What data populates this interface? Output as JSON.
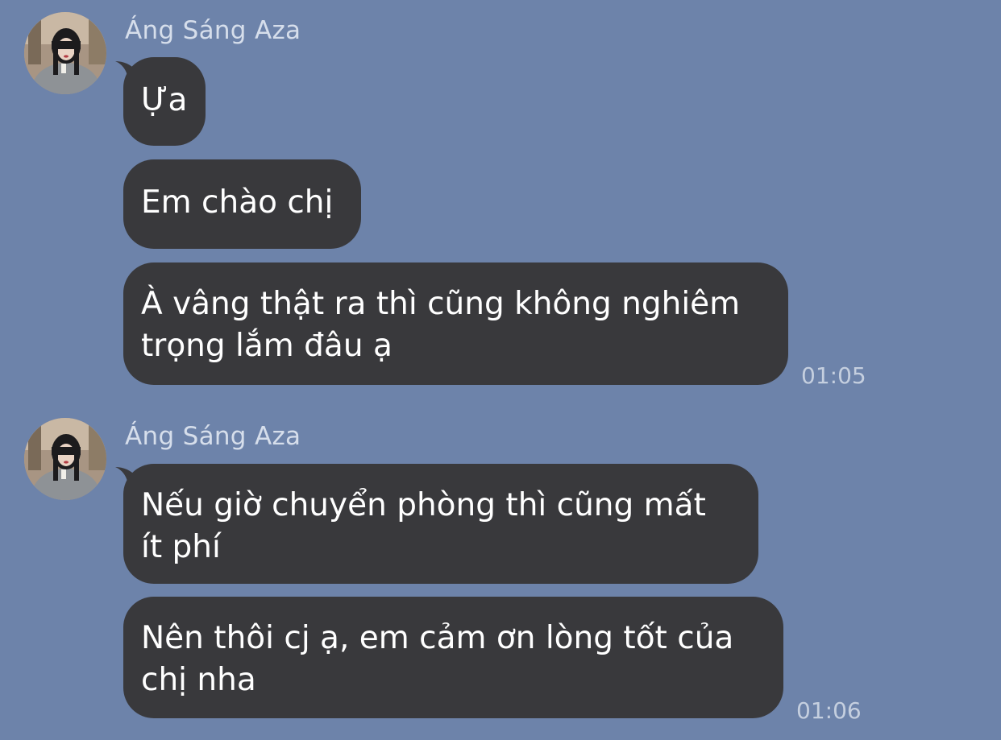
{
  "colors": {
    "background": "#6d83aa",
    "bubble": "#39393c",
    "bubble_text": "#ffffff",
    "sender_text": "#d6deeb",
    "time_text": "#c5cfdf"
  },
  "groups": [
    {
      "sender": "Áng Sáng Aza",
      "avatar_icon": "profile-photo",
      "messages": [
        {
          "lines": [
            "Ựa"
          ]
        },
        {
          "lines": [
            "Em chào chị"
          ]
        },
        {
          "lines": [
            "À vâng thật ra thì cũng không nghiêm",
            "trọng lắm đâu ạ"
          ]
        }
      ],
      "time": "01:05"
    },
    {
      "sender": "Áng Sáng Aza",
      "avatar_icon": "profile-photo",
      "messages": [
        {
          "lines": [
            "Nếu giờ chuyển phòng thì cũng mất",
            "ít phí"
          ]
        },
        {
          "lines": [
            "Nên thôi cj ạ, em cảm ơn lòng tốt của",
            "chị nha"
          ]
        }
      ],
      "time": "01:06"
    }
  ]
}
